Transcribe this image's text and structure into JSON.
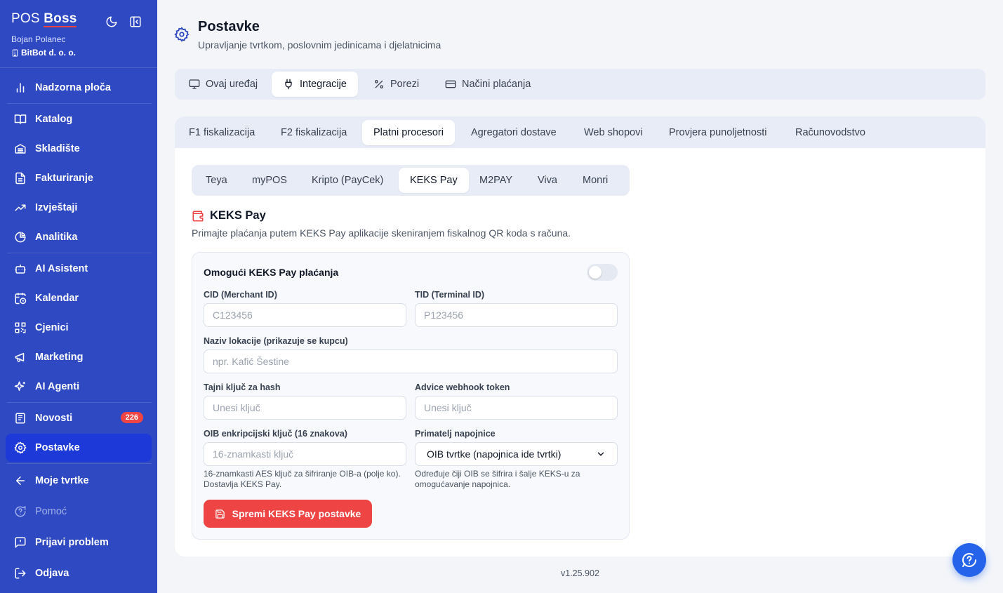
{
  "brand": {
    "part1": "POS",
    "part2": "Boss"
  },
  "user": {
    "name": "Bojan Polanec",
    "company": "BitBot d. o. o."
  },
  "sidebar": {
    "items": [
      {
        "label": "Nadzorna ploča",
        "icon": "bar-chart-icon"
      },
      {
        "label": "Katalog",
        "icon": "book-icon"
      },
      {
        "label": "Skladište",
        "icon": "warehouse-icon"
      },
      {
        "label": "Fakturiranje",
        "icon": "file-text-icon"
      },
      {
        "label": "Izvještaji",
        "icon": "trending-up-icon"
      },
      {
        "label": "Analitika",
        "icon": "pie-chart-icon"
      },
      {
        "label": "AI Asistent",
        "icon": "bot-icon"
      },
      {
        "label": "Kalendar",
        "icon": "calendar-clock-icon"
      },
      {
        "label": "Cjenici",
        "icon": "qr-code-icon"
      },
      {
        "label": "Marketing",
        "icon": "megaphone-icon"
      },
      {
        "label": "AI Agenti",
        "icon": "sparkles-icon"
      },
      {
        "label": "Novosti",
        "icon": "newspaper-icon",
        "badge": "226"
      },
      {
        "label": "Postavke",
        "icon": "settings-icon"
      },
      {
        "label": "Moje tvrtke",
        "icon": "arrow-left-icon"
      },
      {
        "label": "Pomoć",
        "icon": "help-circle-icon"
      },
      {
        "label": "Prijavi problem",
        "icon": "message-alert-icon"
      },
      {
        "label": "Odjava",
        "icon": "log-out-icon"
      }
    ]
  },
  "header": {
    "title": "Postavke",
    "subtitle": "Upravljanje tvrtkom, poslovnim jedinicama i djelatnicima"
  },
  "tabs_main": [
    "Ovaj uređaj",
    "Integracije",
    "Porezi",
    "Načini plaćanja"
  ],
  "tabs_integrations": [
    "F1 fiskalizacija",
    "F2 fiskalizacija",
    "Platni procesori",
    "Agregatori dostave",
    "Web shopovi",
    "Provjera punoljetnosti",
    "Računovodstvo"
  ],
  "tabs_processors": [
    "Teya",
    "myPOS",
    "Kripto (PayCek)",
    "KEKS Pay",
    "M2PAY",
    "Viva",
    "Monri"
  ],
  "section": {
    "title": "KEKS Pay",
    "description": "Primajte plaćanja putem KEKS Pay aplikacije skeniranjem fiskalnog QR koda s računa."
  },
  "form": {
    "enable_label": "Omogući KEKS Pay plaćanja",
    "enabled": false,
    "cid_label": "CID (Merchant ID)",
    "cid_placeholder": "C123456",
    "tid_label": "TID (Terminal ID)",
    "tid_placeholder": "P123456",
    "location_label": "Naziv lokacije (prikazuje se kupcu)",
    "location_placeholder": "npr. Kafić Šestine",
    "secret_label": "Tajni ključ za hash",
    "secret_placeholder": "Unesi ključ",
    "webhook_label": "Advice webhook token",
    "webhook_placeholder": "Unesi ključ",
    "oib_label": "OIB enkripcijski ključ (16 znakova)",
    "oib_placeholder": "16-znamkasti ključ",
    "oib_hint": "16-znamkasti AES ključ za šifriranje OIB-a (polje ko). Dostavlja KEKS Pay.",
    "recipient_label": "Primatelj napojnice",
    "recipient_value": "OIB tvrtke (napojnica ide tvrtki)",
    "recipient_hint": "Određuje čiji OIB se šifrira i šalje KEKS-u za omogućavanje napojnica.",
    "save_label": "Spremi KEKS Pay postavke"
  },
  "version": "v1.25.902",
  "colors": {
    "sidebar": "#2f49c3",
    "active": "#1d3ad8",
    "accent": "#ef4444",
    "fab": "#2563eb"
  }
}
